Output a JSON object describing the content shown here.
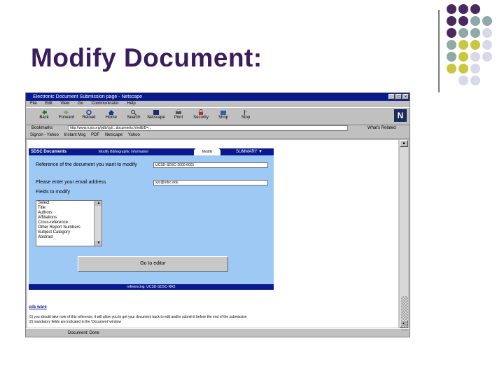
{
  "slide": {
    "title": "Modify Document:",
    "colors": {
      "purple": "#4a2a5e",
      "teal": "#8fa8a8",
      "olive": "#c8c840",
      "lavender": "#d8d8e8"
    }
  },
  "browser": {
    "title": "Electronic Document Submission page - Netscape",
    "menu": [
      "File",
      "Edit",
      "View",
      "Go",
      "Communicator",
      "Help"
    ],
    "toolbar": [
      {
        "label": "Back",
        "icon": "back-arrow-icon"
      },
      {
        "label": "Forward",
        "icon": "forward-arrow-icon"
      },
      {
        "label": "Reload",
        "icon": "reload-icon"
      },
      {
        "label": "Home",
        "icon": "home-icon"
      },
      {
        "label": "Search",
        "icon": "search-icon"
      },
      {
        "label": "Netscape",
        "icon": "netscape-icon"
      },
      {
        "label": "Print",
        "icon": "print-icon"
      },
      {
        "label": "Security",
        "icon": "security-icon"
      },
      {
        "label": "Shop",
        "icon": "shop-icon"
      },
      {
        "label": "Stop",
        "icon": "stop-icon"
      }
    ],
    "location_label": "Bookmarks",
    "location_value": "http://www.rcsb.org/pdb/cgi/...documents.html&ID=...",
    "whats_related": "What's Related",
    "links": [
      "Signon - Yahoo",
      "Instant Msg",
      "PDF",
      "Netscape",
      "Yahoo"
    ],
    "status": "Document: Done"
  },
  "form": {
    "header": "SDSC Documents",
    "header_sub": "Modify Bibliographic Information",
    "tab_active": "Modify",
    "tab_summary": "SUMMARY",
    "ref_label": "Reference of the document you want to modify",
    "ref_value": "UCSD-SDSC-2000-0001",
    "email_label": "Please enter your email address",
    "email_value": "xyz@sdsc.edu",
    "fields_label": "Fields to modify",
    "fields": [
      "Select",
      "Title",
      "Authors",
      "Affiliations",
      "Cross-reference",
      "Other Report Numbers",
      "Subject Category",
      "Abstract"
    ],
    "submit_label": "Go to editor",
    "footer": "referencing: UCSD-SDSC-RR2"
  },
  "page_footer": {
    "logo": "cds ware",
    "notes": [
      "(1) you should take note of this reference; it will allow you to get your document back to edit and/or submit it before the end of the submission",
      "(2) mandatory fields are indicated in the 'Document' window"
    ]
  }
}
